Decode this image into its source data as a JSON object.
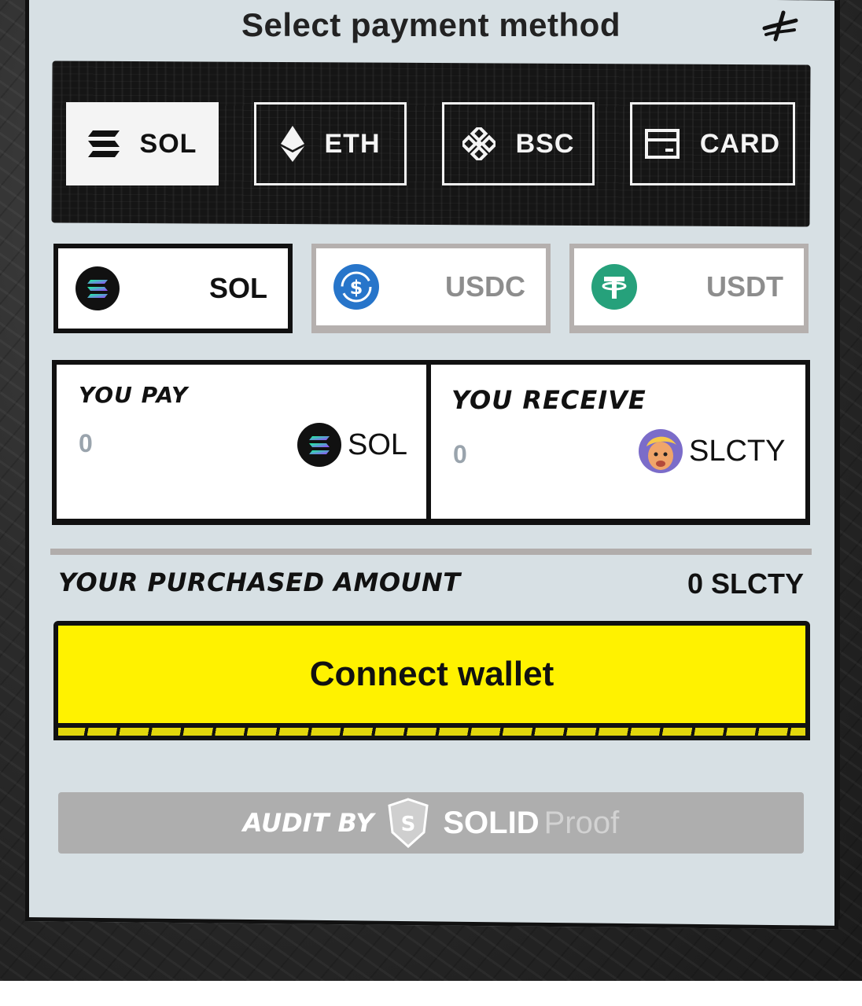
{
  "title": "Select payment method",
  "networks": [
    {
      "label": "SOL",
      "icon": "solana-icon",
      "active": true
    },
    {
      "label": "ETH",
      "icon": "ethereum-icon",
      "active": false
    },
    {
      "label": "BSC",
      "icon": "bnb-icon",
      "active": false
    },
    {
      "label": "CARD",
      "icon": "card-icon",
      "active": false
    }
  ],
  "tokens": [
    {
      "label": "SOL",
      "icon": "solana-icon",
      "active": true
    },
    {
      "label": "USDC",
      "icon": "usdc-icon",
      "active": false
    },
    {
      "label": "USDT",
      "icon": "tether-icon",
      "active": false
    }
  ],
  "pay": {
    "label": "YOU PAY",
    "value": "0",
    "token": "SOL"
  },
  "receive": {
    "label": "YOU RECEIVE",
    "value": "0",
    "token": "SLCTY"
  },
  "purchased": {
    "label": "YOUR PURCHASED AMOUNT",
    "value": "0 SLCTY"
  },
  "connect_label": "Connect wallet",
  "audit": {
    "label": "AUDIT BY",
    "brand_bold": "SOLID",
    "brand_light": "Proof"
  },
  "colors": {
    "accent": "#fff200",
    "panel": "#d7e0e4",
    "dark": "#151515",
    "usdc": "#2775ca",
    "usdt": "#26a17b"
  }
}
